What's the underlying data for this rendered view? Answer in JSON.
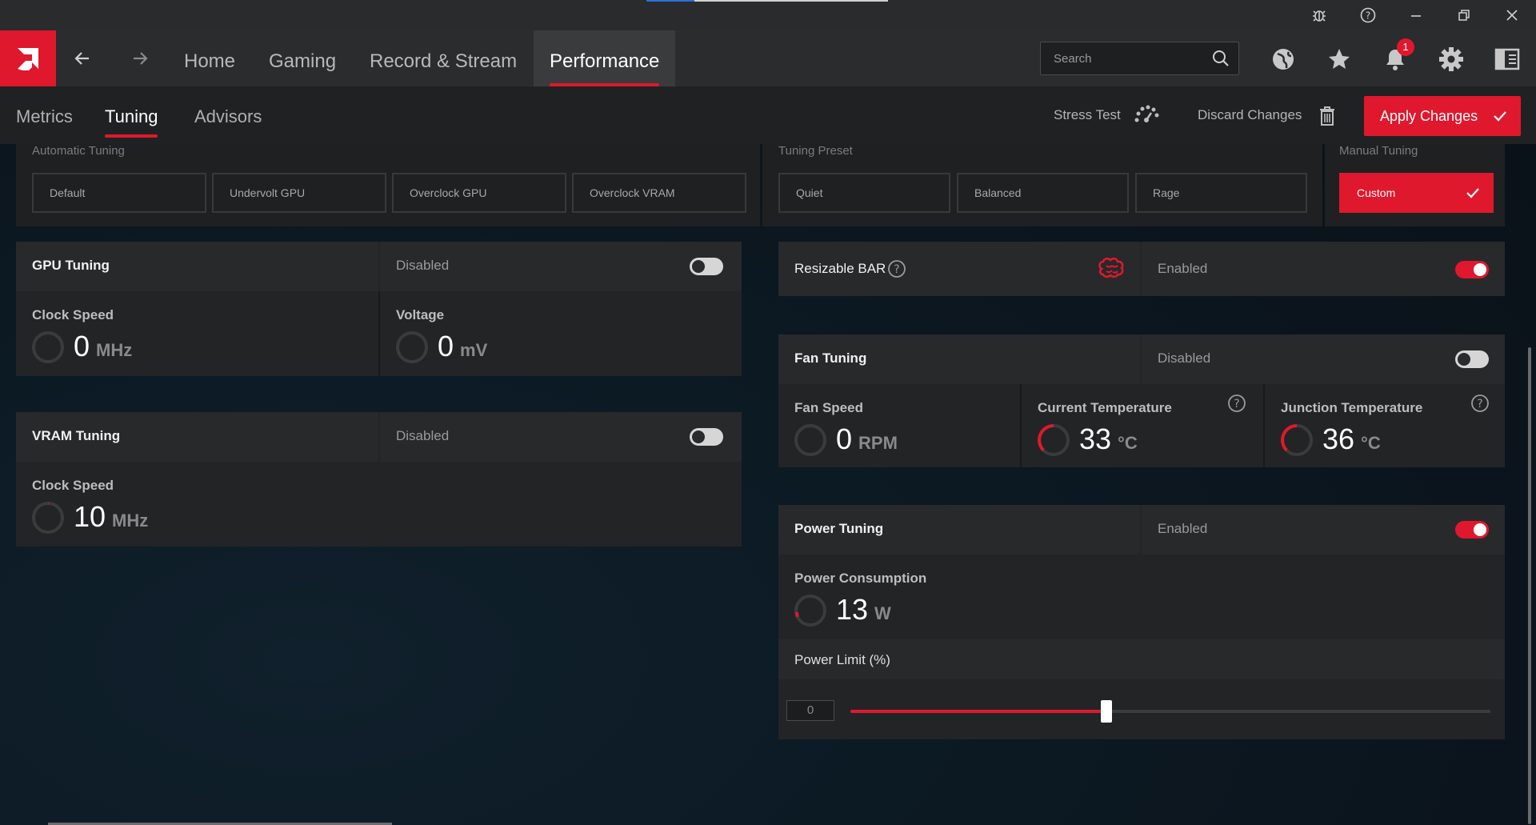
{
  "top_nav": {
    "items": [
      {
        "label": "Home"
      },
      {
        "label": "Gaming"
      },
      {
        "label": "Record & Stream"
      },
      {
        "label": "Performance",
        "active": true
      }
    ],
    "search_placeholder": "Search",
    "notification_count": "1"
  },
  "sub_nav": {
    "items": [
      {
        "label": "Metrics"
      },
      {
        "label": "Tuning",
        "active": true
      },
      {
        "label": "Advisors"
      }
    ],
    "stress_test": "Stress Test",
    "discard_changes": "Discard Changes",
    "apply_changes": "Apply Changes"
  },
  "presets": {
    "automatic": {
      "label": "Automatic Tuning",
      "options": [
        "Default",
        "Undervolt GPU",
        "Overclock GPU",
        "Overclock VRAM"
      ]
    },
    "tuning_preset": {
      "label": "Tuning Preset",
      "options": [
        "Quiet",
        "Balanced",
        "Rage"
      ]
    },
    "manual": {
      "label": "Manual Tuning",
      "option": "Custom",
      "selected": true
    }
  },
  "gpu_tuning": {
    "title": "GPU Tuning",
    "state": "Disabled",
    "enabled": false,
    "clock_speed": {
      "label": "Clock Speed",
      "value": "0",
      "unit": "MHz"
    },
    "voltage": {
      "label": "Voltage",
      "value": "0",
      "unit": "mV"
    }
  },
  "vram_tuning": {
    "title": "VRAM Tuning",
    "state": "Disabled",
    "enabled": false,
    "clock_speed": {
      "label": "Clock Speed",
      "value": "10",
      "unit": "MHz"
    }
  },
  "resizable_bar": {
    "title": "Resizable BAR",
    "state": "Enabled",
    "enabled": true
  },
  "fan_tuning": {
    "title": "Fan Tuning",
    "state": "Disabled",
    "enabled": false,
    "fan_speed": {
      "label": "Fan Speed",
      "value": "0",
      "unit": "RPM"
    },
    "current_temp": {
      "label": "Current Temperature",
      "value": "33",
      "unit": "°C"
    },
    "junction_temp": {
      "label": "Junction Temperature",
      "value": "36",
      "unit": "°C"
    }
  },
  "power_tuning": {
    "title": "Power Tuning",
    "state": "Enabled",
    "enabled": true,
    "consumption": {
      "label": "Power Consumption",
      "value": "13",
      "unit": "W"
    },
    "limit": {
      "label": "Power Limit (%)",
      "value": "0",
      "slider_fraction": 0.4
    }
  },
  "colors": {
    "accent": "#e0182d",
    "panel": "#232426",
    "header": "#28292b"
  }
}
